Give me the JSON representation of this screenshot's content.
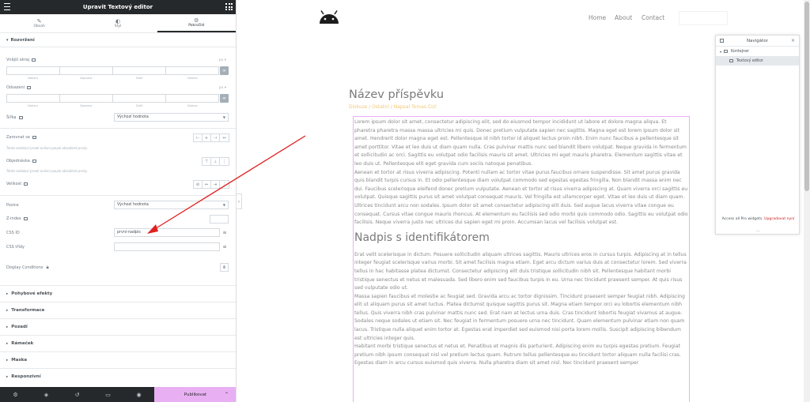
{
  "panel": {
    "title": "Upravit Textový editor",
    "tabs": [
      {
        "icon": "✎",
        "label": "Obsah"
      },
      {
        "icon": "◐",
        "label": "Styl"
      },
      {
        "icon": "⚙",
        "label": "Pokročilé"
      }
    ],
    "section_open": "Rozvržení",
    "margin_label": "Vnější okraj",
    "padding_label": "Odsazení",
    "units": "px",
    "dims_labels": [
      "Nahoru",
      "Doprava",
      "Dolů",
      "Doleva"
    ],
    "width_label": "Šířka",
    "width_value": "Výchozí hodnota",
    "align_label": "Zarovnat se",
    "align_hint": "Tento ovládací prvek ovlivní pouze obsažené prvky.",
    "order_label": "Objednávka",
    "order_hint": "Tento ovládací prvek ovlivní pouze obsažené prvky.",
    "size_label": "Velikost",
    "position_label": "Pozice",
    "position_value": "Výchozí hodnota",
    "zindex_label": "Z-index",
    "cssid_label": "CSS ID",
    "cssid_value": "prvni-nadpis",
    "cssclasses_label": "CSS třídy",
    "display_conditions_label": "Display Conditions",
    "collapsed_sections": [
      "Pohybové efekty",
      "Transformace",
      "Pozadí",
      "Rámeček",
      "Maska",
      "Responzivní"
    ],
    "publish_label": "Publikovat"
  },
  "site": {
    "nav": [
      "Home",
      "About",
      "Contact"
    ],
    "post_title": "Název příspěvku",
    "post_meta": "Diskuze / Ostatní / Napsal Tomas Cizl",
    "heading2": "Nadpis s identifikátorem",
    "para1": "Lorem ipsum dolor sit amet, consectetur adipiscing elit, sed do eiusmod tempor incididunt ut labore et dolore magna aliqua. Et pharetra pharetra massa massa ultricies mi quis. Donec pretium vulputate sapien nec sagittis. Magna eget est lorem ipsum dolor sit amet. Hendrerit dolor magna eget est. Pellentesque id nibh tortor id aliquet lectus proin nibh. Enim nunc faucibus a pellentesque sit amet porttitor. Vitae et leo duis ut diam quam nulla. Cras pulvinar mattis nunc sed blandit libero volutpat. Neque gravida in fermentum et sollicitudin ac orci. Sagittis eu volutpat odio facilisis mauris sit amet. Ultricies mi eget mauris pharetra. Elementum sagittis vitae et leo duis ut. Pellentesque elit eget gravida cum sociis natoque penatibus.",
    "para2": "Aenean et tortor at risus viverra adipiscing. Potenti nullam ac tortor vitae purus faucibus ornare suspendisse. Sit amet purus gravida quis blandit turpis cursus in. Et odio pellentesque diam volutpat commodo sed egestas egestas fringilla. Non blandit massa enim nec dui. Faucibus scelerisque eleifend donec pretium vulputate. Aenean et tortor at risus viverra adipiscing at. Quam viverra orci sagittis eu volutpat. Quisque sagittis purus sit amet volutpat consequat mauris. Vel fringilla est ullamcorper eget. Vitae et leo duis ut diam quam. Ultrices tincidunt arcu non sodales. Ipsum dolor sit amet consectetur adipiscing elit duis. Sed augue lacus viverra vitae congue eu consequat. Cursus vitae congue mauris rhoncus. At elementum eu facilisis sed odio morbi quis commodo odio. Sagittis eu volutpat odio facilisis. Neque viverra justo nec ultrices dui sapien eget mi proin. Accumsan lacus vel facilisis volutpat est.",
    "para3": "Erat velit scelerisque in dictum. Posuere sollicitudin aliquam ultrices sagittis. Mauris ultrices eros in cursus turpis. Adipiscing at in tellus integer feugiat scelerisque varius morbi. Sit amet facilisis magna etiam. Eget arcu dictum varius duis at consectetur lorem. Sed viverra tellus in hac habitasse platea dictumst. Consectetur adipiscing elit duis tristique sollicitudin nibh sit. Pellentesque habitant morbi tristique senectus et netus et malesuada. Sed libero enim sed faucibus turpis in eu. Urna nec tincidunt praesent semper. At quis risus sed vulputate odio ut.",
    "para4": "Massa sapien faucibus et molestie ac feugiat sed. Gravida arcu ac tortor dignissim. Tincidunt praesent semper feugiat nibh. Adipiscing elit ut aliquam purus sit amet luctus. Platea dictumst quisque sagittis purus sit. Magna etiam tempor orci eu lobortis elementum nibh tellus. Quis viverra nibh cras pulvinar mattis nunc sed. Erat nam at lectus urna duis. Cras tincidunt lobortis feugiat vivamus at augue. Sodales neque sodales ut etiam sit. Nec feugiat in fermentum posuere urna nec tincidunt. Quam elementum pulvinar etiam non quam lacus. Tristique nulla aliquet enim tortor at. Egestas erat imperdiet sed euismod nisi porta lorem mollis. Suscipit adipiscing bibendum est ultricies integer quis.",
    "para5": "Habitant morbi tristique senectus et netus et. Penatibus et magnis dis parturient. Adipiscing enim eu turpis egestas pretium. Feugiat pretium nibh ipsum consequat nisl vel pretium lectus quam. Rutrum tellus pellentesque eu tincidunt tortor aliquam nulla facilisi cras. Egestas diam in arcu cursus euismod quis viverra. Nulla pharetra diam sit amet nisl. Nec tincidunt praesent semper"
  },
  "navigator": {
    "title": "Navigátor",
    "items": [
      "Kontejner",
      "Textový editor"
    ],
    "pro_text": "Access all Pro widgets.",
    "pro_link": "Upgradovat nyní"
  },
  "colors": {
    "accent_pink": "#e8b0f2",
    "arrow_red": "#e02020",
    "dark": "#26292c"
  }
}
